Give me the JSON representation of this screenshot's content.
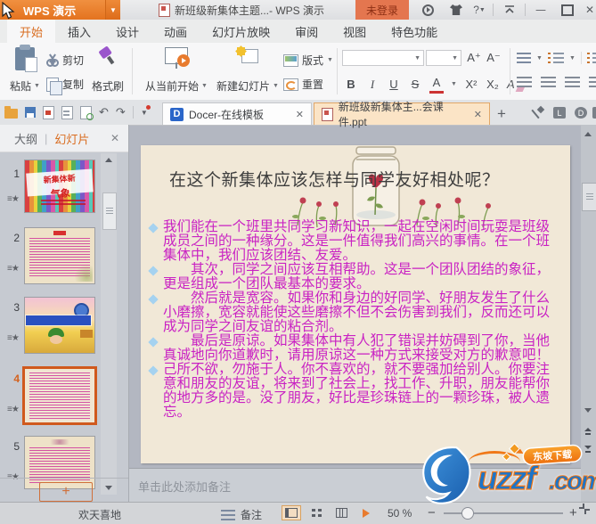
{
  "titlebar": {
    "app_button": "WPS 演示",
    "doc_title": "新班级新集体主题...- WPS 演示",
    "login_button": "未登录",
    "help_label": "?"
  },
  "ribbon_tabs": {
    "items": [
      "开始",
      "插入",
      "设计",
      "动画",
      "幻灯片放映",
      "审阅",
      "视图",
      "特色功能"
    ],
    "active": "开始"
  },
  "ribbon": {
    "paste": "粘贴",
    "cut": "剪切",
    "copy": "复制",
    "format_painter": "格式刷",
    "from_current": "从当前开始",
    "new_slide": "新建幻灯片",
    "layout": "版式",
    "reset": "重置",
    "grow_font": "A⁺",
    "shrink_font": "A⁻",
    "bold": "B",
    "italic": "I",
    "underline": "U",
    "strikethrough": "S",
    "font_color": "A",
    "superscript": "X²",
    "subscript": "X₂"
  },
  "doc_tabs": {
    "tab1": "Docer-在线模板",
    "tab2": "新班级新集体主...会课件.ppt"
  },
  "sidebar": {
    "outline_label": "大纲",
    "slides_label": "幻灯片",
    "slide_nums": [
      "1",
      "2",
      "3",
      "4",
      "5"
    ],
    "slide1_title_line1": "新集体新",
    "slide1_title_line2": "气象"
  },
  "slide": {
    "title": "在这个新集体应该怎样与同学友好相处呢？",
    "bullets": [
      "我们能在一个班里共同学习新知识，一起在空闲时间玩耍是班级成员之间的一种缘分。这是一件值得我们高兴的事情。在一个班集体中，我们应该团结、友爱。",
      "　　其次，同学之间应该互相帮助。这是一个团队团结的象征，更是组成一个团队最基本的要求。",
      "　　然后就是宽容。如果你和身边的好同学、好朋友发生了什么小磨擦，宽容就能使这些磨擦不但不会伤害到我们，反而还可以成为同学之间友谊的粘合剂。",
      "　　最后是原谅。如果集体中有人犯了错误并妨碍到了你，当他真诚地向你道歉时，请用原谅这一种方式来接受对方的歉意吧！",
      "己所不欲，勿施于人。你不喜欢的，就不要强加给别人。你要注意和朋友的友谊，将来到了社会上，找工作、升职，朋友能帮你的地方多的是。没了朋友，好比是珍珠链上的一颗珍珠，被人遗忘。"
    ]
  },
  "notes": {
    "placeholder": "单击此处添加备注"
  },
  "statusbar": {
    "theme": "欢天喜地",
    "notes_label": "备注",
    "zoom_percent": "50 %"
  },
  "watermark": {
    "logo_text": "uzzf",
    "logo_tld": ".com",
    "badge": "东坡下载"
  },
  "colors": {
    "accent_orange": "#e87b2e",
    "body_magenta": "#c922c3",
    "slide_cream": "#f1e8d7",
    "logo_blue": "#1d74c8"
  }
}
